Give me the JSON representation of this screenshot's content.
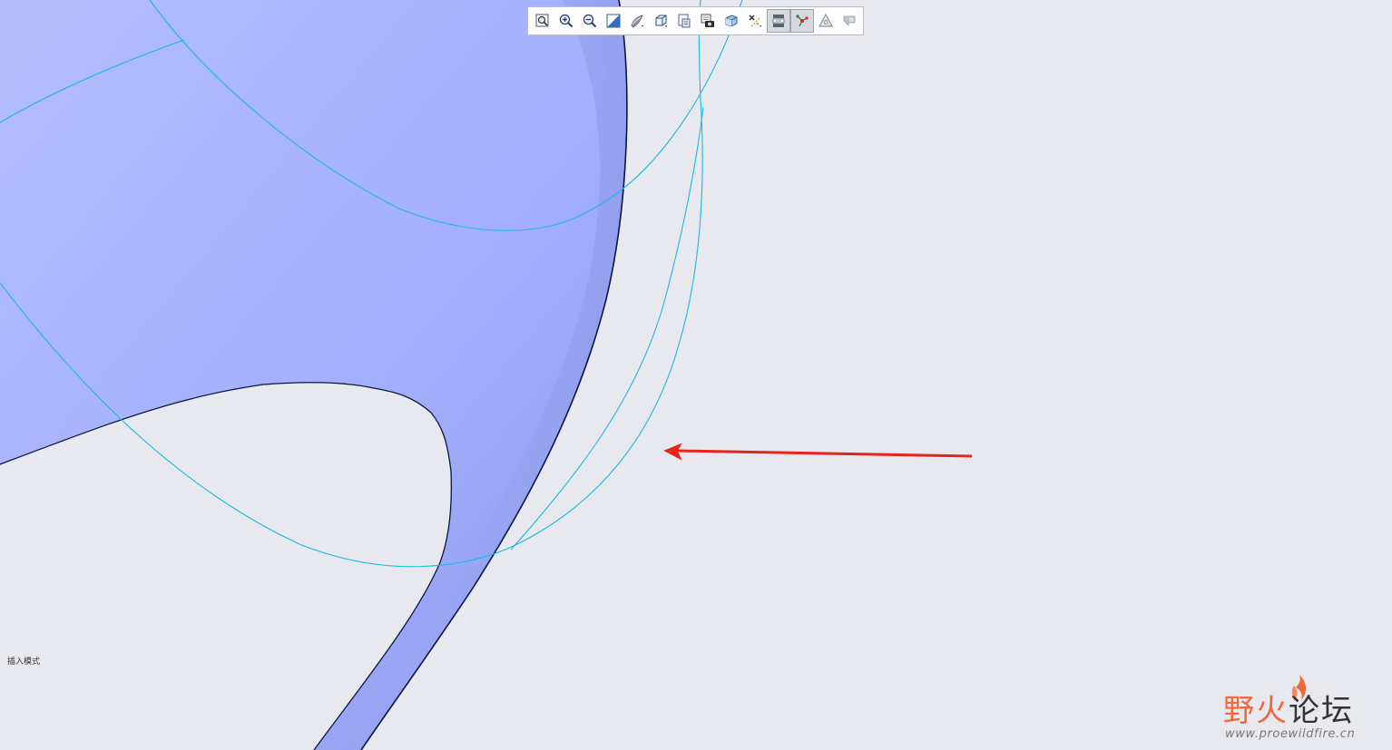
{
  "toolbar": {
    "buttons": [
      {
        "name": "refit-button",
        "icon": "refit-icon"
      },
      {
        "name": "zoom-in-button",
        "icon": "zoom-in-icon"
      },
      {
        "name": "zoom-out-button",
        "icon": "zoom-out-icon"
      },
      {
        "name": "repaint-button",
        "icon": "repaint-icon"
      },
      {
        "name": "display-style-button",
        "icon": "shading-icon"
      },
      {
        "name": "saved-orientations-button",
        "icon": "cube-icon"
      },
      {
        "name": "view-manager-button",
        "icon": "view-manager-icon"
      },
      {
        "name": "named-views-button",
        "icon": "camera-icon"
      },
      {
        "name": "perspective-button",
        "icon": "box-view-icon"
      },
      {
        "name": "datum-display-button",
        "icon": "datum-display-icon"
      },
      {
        "name": "annotation-display-button",
        "icon": "annotation-display-icon"
      },
      {
        "name": "spin-center-button",
        "icon": "spin-center-icon"
      },
      {
        "name": "datum-points-button",
        "icon": "triangle-icon"
      },
      {
        "name": "flag-button",
        "icon": "flag-icon"
      }
    ],
    "active": [
      "annotation-display-button",
      "spin-center-button"
    ]
  },
  "status": {
    "mode_label": "插入模式"
  },
  "watermark": {
    "brand_part1": "野火",
    "brand_part2": "论坛",
    "url": "www.proewildfire.cn"
  },
  "colors": {
    "background": "#e8e9ee",
    "surface": "#a6b2fc",
    "curve": "#1ab8e6",
    "edge": "#0b1640",
    "arrow": "#e8221c",
    "watermark_accent": "#f2683c"
  }
}
